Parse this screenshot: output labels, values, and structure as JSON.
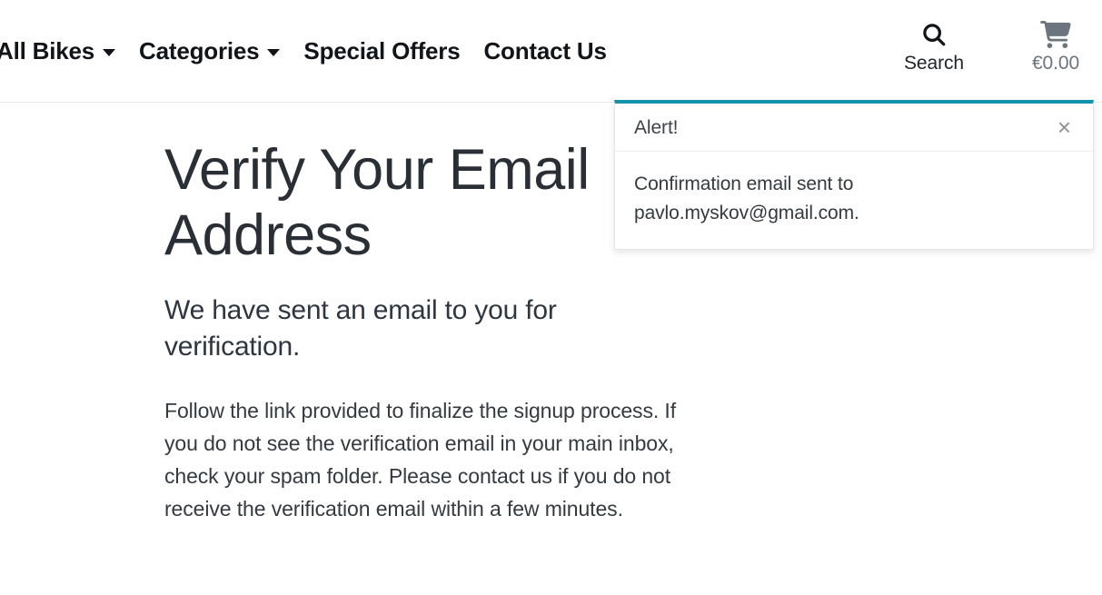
{
  "header": {
    "nav_items": [
      {
        "label": "All Bikes",
        "has_caret": true
      },
      {
        "label": "Categories",
        "has_caret": true
      },
      {
        "label": "Special Offers",
        "has_caret": false
      },
      {
        "label": "Contact Us",
        "has_caret": false
      }
    ],
    "search": {
      "icon": "search-icon",
      "label": "Search"
    },
    "cart": {
      "icon": "shopping-cart-icon",
      "total": "€0.00"
    }
  },
  "main": {
    "title": "Verify Your Email Address",
    "lead": "We have sent an email to you for verification.",
    "body": "Follow the link provided to finalize the signup process. If you do not see the verification email in your main inbox, check your spam folder. Please contact us if you do not receive the verification email within a few minutes."
  },
  "alert": {
    "title": "Alert!",
    "close_label": "×",
    "message": "Confirmation email sent to pavlo.myskov@gmail.com.",
    "accent_color": "#1792ae"
  }
}
